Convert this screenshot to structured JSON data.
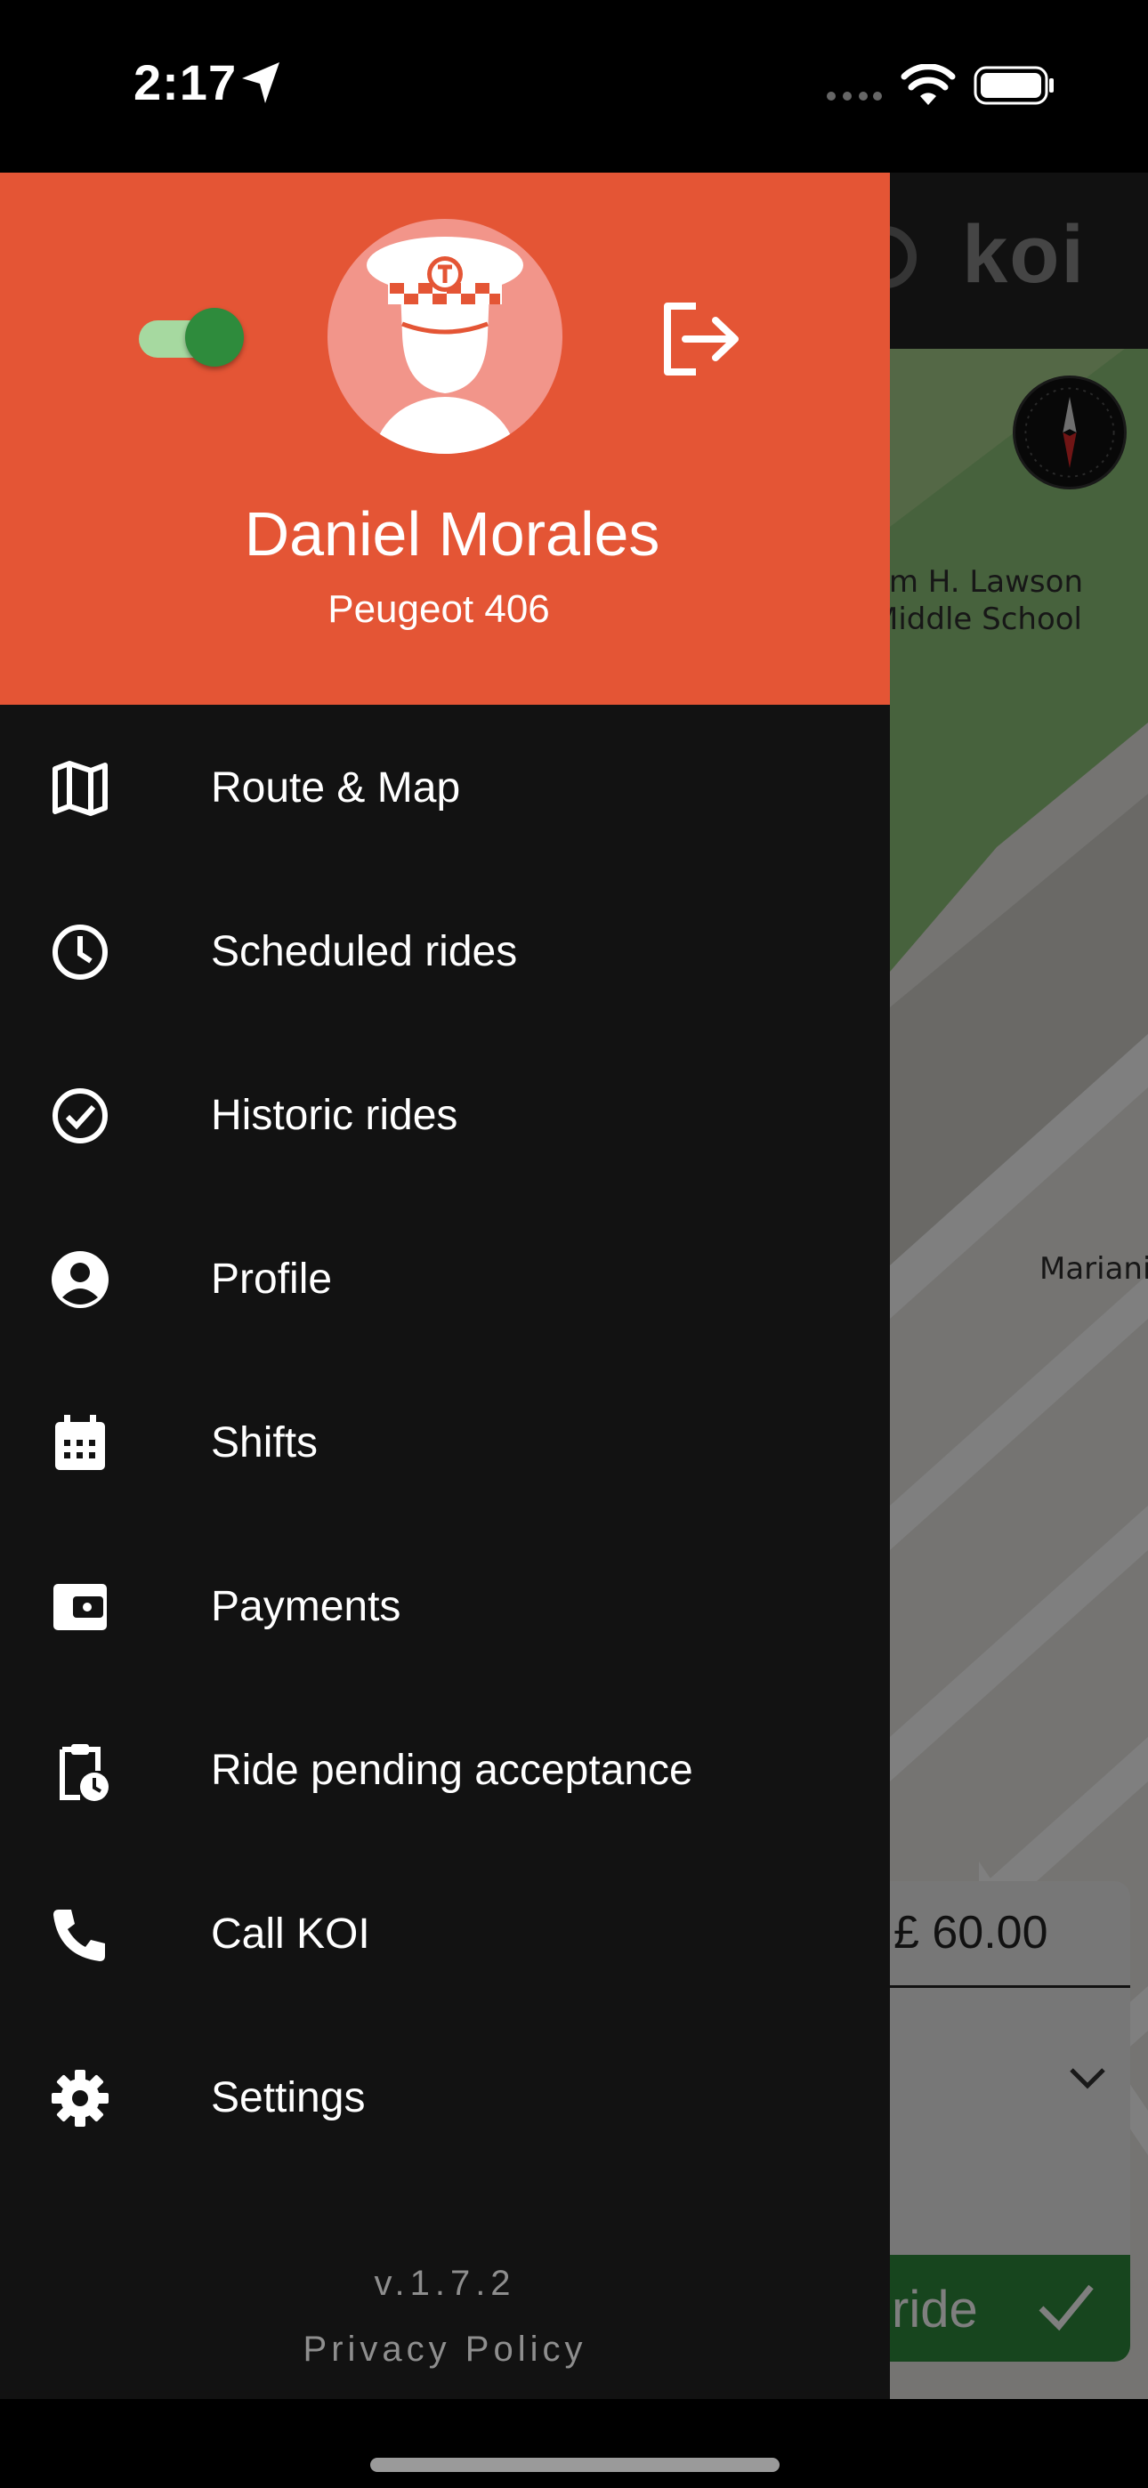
{
  "status_bar": {
    "time": "2:17",
    "location_icon": "location-arrow-icon",
    "signal_icon": "signal-dots-icon",
    "wifi_icon": "wifi-icon",
    "battery_icon": "battery-icon"
  },
  "background_app": {
    "logo": "koi",
    "map_labels": [
      "am H. Lawson",
      "Middle School",
      "Mariani"
    ],
    "fare": "£ 60.00",
    "accept_label": "ride",
    "compass_icon": "compass-icon"
  },
  "drawer": {
    "online_toggle": {
      "on": true,
      "color": "#2e8b3c"
    },
    "driver_name": "Daniel Morales",
    "vehicle": "Peugeot 406",
    "header_color": "#e45535",
    "menu": [
      {
        "label": "Route & Map",
        "icon": "map-icon"
      },
      {
        "label": "Scheduled rides",
        "icon": "clock-icon"
      },
      {
        "label": "Historic rides",
        "icon": "check-circle-icon"
      },
      {
        "label": "Profile",
        "icon": "account-circle-icon"
      },
      {
        "label": "Shifts",
        "icon": "calendar-icon"
      },
      {
        "label": "Payments",
        "icon": "wallet-icon"
      },
      {
        "label": "Ride pending acceptance",
        "icon": "clipboard-clock-icon"
      },
      {
        "label": "Call KOI",
        "icon": "phone-icon"
      },
      {
        "label": "Settings",
        "icon": "gear-icon"
      }
    ],
    "version": "v.1.7.2",
    "privacy_policy": "Privacy Policy"
  }
}
